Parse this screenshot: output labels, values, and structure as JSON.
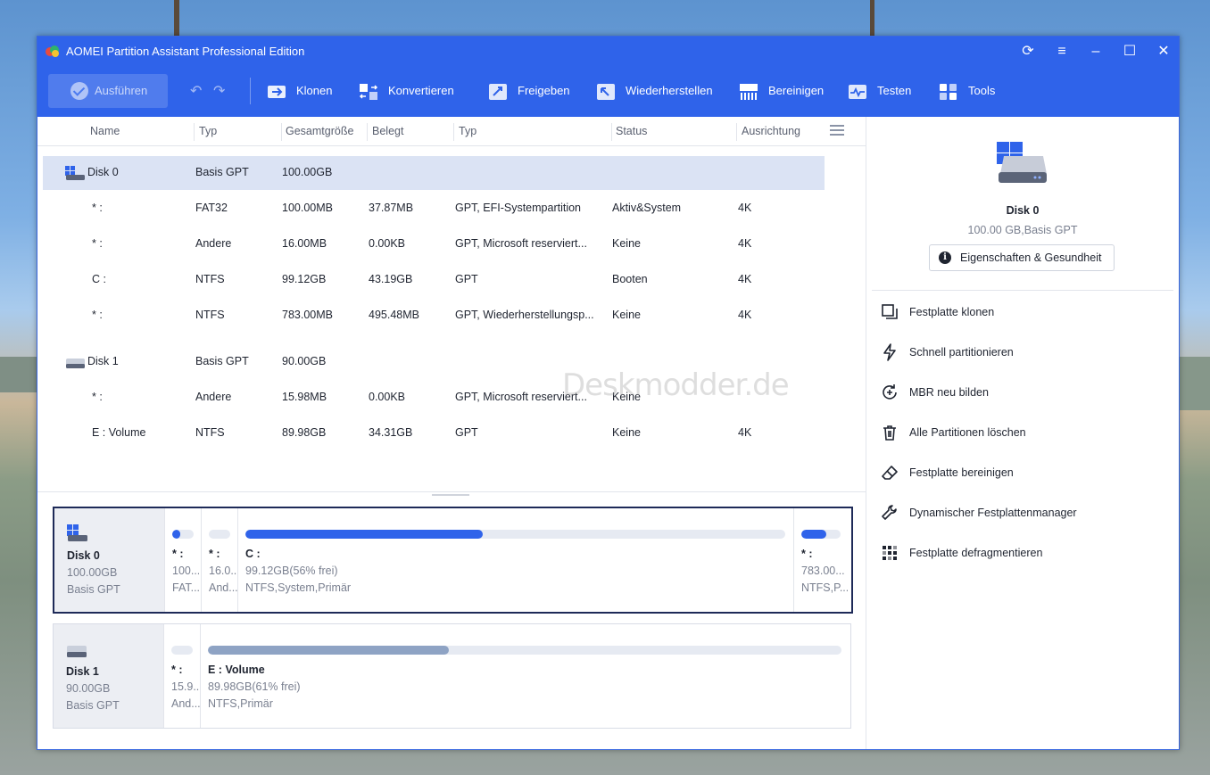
{
  "window": {
    "title": "AOMEI Partition Assistant Professional Edition"
  },
  "toolbar": {
    "apply_label": "Ausführen",
    "tools": [
      {
        "label": "Klonen",
        "icon": "clone-icon"
      },
      {
        "label": "Konvertieren",
        "icon": "convert-icon"
      },
      {
        "label": "Freigeben",
        "icon": "free-up-icon"
      },
      {
        "label": "Wiederherstellen",
        "icon": "restore-icon"
      },
      {
        "label": "Bereinigen",
        "icon": "wipe-icon"
      },
      {
        "label": "Testen",
        "icon": "test-icon"
      },
      {
        "label": "Tools",
        "icon": "tools-icon"
      }
    ]
  },
  "table": {
    "headers": [
      "Name",
      "Typ",
      "Gesamtgröße",
      "Belegt",
      "Typ",
      "Status",
      "Ausrichtung"
    ],
    "rows": [
      {
        "name": "Disk 0",
        "type": "Basis GPT",
        "size": "100.00GB",
        "used": "",
        "ptype": "",
        "status": "",
        "align": "",
        "disk": true
      },
      {
        "name": "* :",
        "type": "FAT32",
        "size": "100.00MB",
        "used": "37.87MB",
        "ptype": "GPT, EFI-Systempartition",
        "status": "Aktiv&System",
        "align": "4K"
      },
      {
        "name": "* :",
        "type": "Andere",
        "size": "16.00MB",
        "used": "0.00KB",
        "ptype": "GPT, Microsoft reserviert...",
        "status": "Keine",
        "align": "4K"
      },
      {
        "name": "C :",
        "type": "NTFS",
        "size": "99.12GB",
        "used": "43.19GB",
        "ptype": "GPT",
        "status": "Booten",
        "align": "4K"
      },
      {
        "name": "* :",
        "type": "NTFS",
        "size": "783.00MB",
        "used": "495.48MB",
        "ptype": "GPT, Wiederherstellungsp...",
        "status": "Keine",
        "align": "4K"
      },
      {
        "name": "Disk 1",
        "type": "Basis GPT",
        "size": "90.00GB",
        "used": "",
        "ptype": "",
        "status": "",
        "align": "",
        "disk": true
      },
      {
        "name": "* :",
        "type": "Andere",
        "size": "15.98MB",
        "used": "0.00KB",
        "ptype": "GPT, Microsoft reserviert...",
        "status": "Keine",
        "align": ""
      },
      {
        "name": "E : Volume",
        "type": "NTFS",
        "size": "89.98GB",
        "used": "34.31GB",
        "ptype": "GPT",
        "status": "Keine",
        "align": "4K"
      }
    ]
  },
  "diskmap": {
    "disk0": {
      "name": "Disk 0",
      "size": "100.00GB",
      "type": "Basis GPT",
      "partitions": [
        {
          "name": "* :",
          "line1": "100....",
          "line2": "FAT...",
          "fill": 0.38
        },
        {
          "name": "* :",
          "line1": "16.0...",
          "line2": "And...",
          "fill": 0.0
        },
        {
          "name": "C :",
          "line1": "99.12GB(56% frei)",
          "line2": "NTFS,System,Primär",
          "fill": 0.44
        },
        {
          "name": "* :",
          "line1": "783.00...",
          "line2": "NTFS,P...",
          "fill": 0.63
        }
      ]
    },
    "disk1": {
      "name": "Disk 1",
      "size": "90.00GB",
      "type": "Basis GPT",
      "partitions": [
        {
          "name": "* :",
          "line1": "15.9...",
          "line2": "And...",
          "fill": 0.0
        },
        {
          "name": "E : Volume",
          "line1": "89.98GB(61% frei)",
          "line2": "NTFS,Primär",
          "fill": 0.38
        }
      ]
    }
  },
  "details": {
    "title": "Disk 0",
    "subtitle": "100.00 GB,Basis GPT",
    "properties_label": "Eigenschaften & Gesundheit",
    "actions": [
      {
        "label": "Festplatte klonen",
        "icon": "disk-clone-icon"
      },
      {
        "label": "Schnell partitionieren",
        "icon": "lightning-icon"
      },
      {
        "label": "MBR neu bilden",
        "icon": "rebuild-mbr-icon"
      },
      {
        "label": "Alle Partitionen löschen",
        "icon": "trash-icon"
      },
      {
        "label": "Festplatte bereinigen",
        "icon": "eraser-icon"
      },
      {
        "label": "Dynamischer Festplattenmanager",
        "icon": "wrench-icon"
      },
      {
        "label": "Festplatte defragmentieren",
        "icon": "defrag-icon"
      }
    ]
  },
  "watermark": "Deskmodder.de",
  "colors": {
    "accent": "#2f63ea",
    "selected_row": "#dbe3f4",
    "disk_map_bar": "#2f63ea",
    "disk1_bar": "#8ea3c4"
  }
}
